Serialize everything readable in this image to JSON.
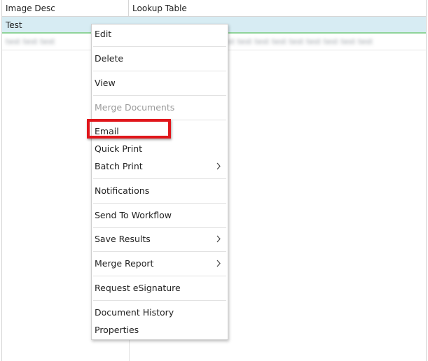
{
  "grid": {
    "columns": [
      "Image Desc",
      "Lookup Table"
    ],
    "rows": [
      {
        "image_desc": "Test",
        "lookup_table": ""
      },
      {
        "image_desc": "test test test",
        "lookup_table": "test test test test test test test test test"
      }
    ]
  },
  "context_menu": {
    "items": [
      {
        "label": "Edit",
        "enabled": true,
        "submenu": false
      },
      {
        "label": "Delete",
        "enabled": true,
        "submenu": false
      },
      {
        "label": "View",
        "enabled": true,
        "submenu": false
      },
      {
        "label": "Merge Documents",
        "enabled": false,
        "submenu": false
      },
      {
        "label": "Email",
        "enabled": true,
        "submenu": false
      },
      {
        "label": "Quick Print",
        "enabled": true,
        "submenu": false
      },
      {
        "label": "Batch Print",
        "enabled": true,
        "submenu": true
      },
      {
        "label": "Notifications",
        "enabled": true,
        "submenu": false
      },
      {
        "label": "Send To Workflow",
        "enabled": true,
        "submenu": false
      },
      {
        "label": "Save Results",
        "enabled": true,
        "submenu": true
      },
      {
        "label": "Merge Report",
        "enabled": true,
        "submenu": true
      },
      {
        "label": "Request eSignature",
        "enabled": true,
        "submenu": false
      },
      {
        "label": "Document History",
        "enabled": true,
        "submenu": false
      },
      {
        "label": "Properties",
        "enabled": true,
        "submenu": false
      }
    ]
  },
  "colors": {
    "selected_row_bg": "#d7ecf3",
    "selected_row_underline": "#8fd39a",
    "highlight_box": "#e0161b",
    "disabled_text": "#9a9a9a"
  }
}
